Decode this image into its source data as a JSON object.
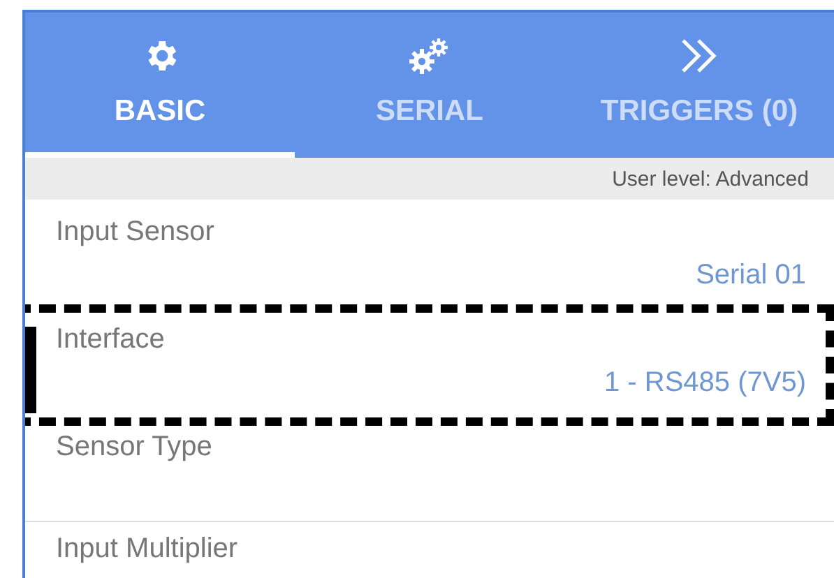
{
  "tabs": [
    {
      "label": "BASIC",
      "selected": true
    },
    {
      "label": "SERIAL",
      "selected": false
    },
    {
      "label": "TRIGGERS (0)",
      "selected": false
    }
  ],
  "user_level": "User level: Advanced",
  "fields": [
    {
      "label": "Input Sensor",
      "value": "Serial 01",
      "highlighted": false
    },
    {
      "label": "Interface",
      "value": "1 - RS485 (7V5)",
      "highlighted": true
    },
    {
      "label": "Sensor Type",
      "highlighted": false
    },
    {
      "label": "Input Multiplier",
      "highlighted": false
    }
  ]
}
